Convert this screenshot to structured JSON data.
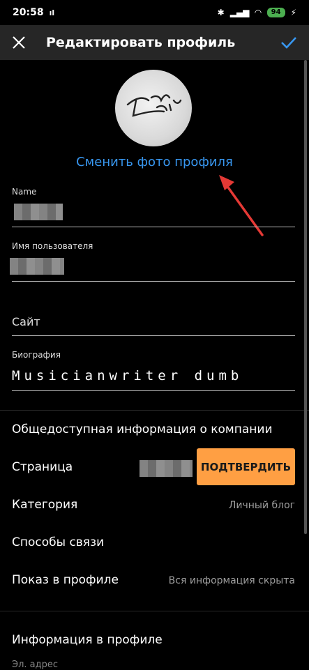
{
  "status": {
    "time": "20:58",
    "signal": "▓",
    "battery": "94"
  },
  "header": {
    "title": "Редактировать профиль"
  },
  "profile": {
    "change_photo": "Сменить фото профиля"
  },
  "fields": {
    "name_label": "Name",
    "username_label": "Имя пользователя",
    "site_placeholder": "Сайт",
    "bio_label": "Биография",
    "bio_value": "Musicianwriter dumb"
  },
  "business": {
    "section_title": "Общедоступная информация о компании",
    "page_label": "Страница",
    "confirm_button": "ПОДТВЕРДИТЬ",
    "category_label": "Категория",
    "category_value": "Личный блог",
    "contacts_label": "Способы связи",
    "display_label": "Показ в профиле",
    "display_value": "Вся информация скрыта"
  },
  "profile_info": {
    "title": "Информация в профиле",
    "email_label": "Эл. адрес"
  },
  "colors": {
    "accent": "#3897f0",
    "confirm": "#ff9f43",
    "appbar": "#262626"
  }
}
